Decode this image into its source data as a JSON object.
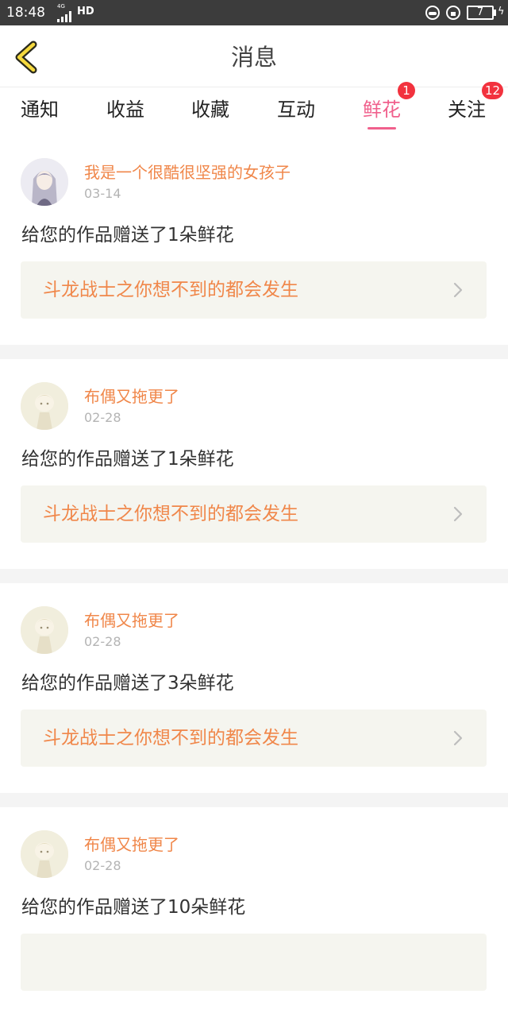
{
  "status_bar": {
    "time": "18:48",
    "network": "4G",
    "hd": "HD",
    "battery": "7"
  },
  "header": {
    "title": "消息",
    "back_icon": "chevron-left-icon",
    "accent_color": "#f0608c"
  },
  "tabs": [
    {
      "label": "通知",
      "badge": ""
    },
    {
      "label": "收益",
      "badge": ""
    },
    {
      "label": "收藏",
      "badge": ""
    },
    {
      "label": "互动",
      "badge": ""
    },
    {
      "label": "鲜花",
      "badge": "1",
      "active": true
    },
    {
      "label": "关注",
      "badge": "12"
    }
  ],
  "items": [
    {
      "user": "我是一个很酷很坚强的女孩子",
      "date": "03-14",
      "message": "给您的作品赠送了1朵鲜花",
      "work": "斗龙战士之你想不到的都会发生"
    },
    {
      "user": "布偶又拖更了",
      "date": "02-28",
      "message": "给您的作品赠送了1朵鲜花",
      "work": "斗龙战士之你想不到的都会发生"
    },
    {
      "user": "布偶又拖更了",
      "date": "02-28",
      "message": "给您的作品赠送了3朵鲜花",
      "work": "斗龙战士之你想不到的都会发生"
    },
    {
      "user": "布偶又拖更了",
      "date": "02-28",
      "message": "给您的作品赠送了10朵鲜花",
      "work": ""
    }
  ]
}
